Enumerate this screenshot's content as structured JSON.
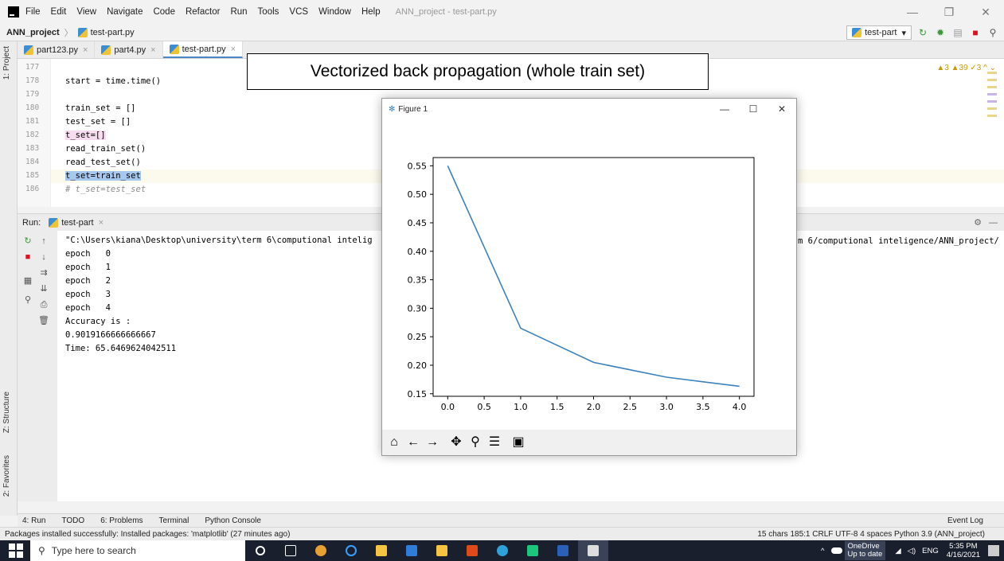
{
  "menu": {
    "items": [
      "File",
      "Edit",
      "View",
      "Navigate",
      "Code",
      "Refactor",
      "Run",
      "Tools",
      "VCS",
      "Window",
      "Help"
    ],
    "window_title": "ANN_project - test-part.py"
  },
  "nav": {
    "project": "ANN_project",
    "file": "test-part.py"
  },
  "run_config": {
    "label": "test-part"
  },
  "tabs": [
    "part123.py",
    "part4.py",
    "test-part.py"
  ],
  "editor": {
    "line_numbers": [
      "177",
      "178",
      "179",
      "180",
      "181",
      "182",
      "183",
      "184",
      "185",
      "186"
    ],
    "lines": [
      "",
      "start = time.time()",
      "",
      "train_set = []",
      "test_set = []",
      "t_set=[]",
      "read_train_set()",
      "read_test_set()",
      "t_set=train_set",
      "# t_set=test_set"
    ],
    "inspections": "▲3  ▲39  ✓3  ^  ⌄"
  },
  "caption": "Vectorized back propagation (whole train set)",
  "run": {
    "header": "Run:",
    "config": "test-part",
    "lines": [
      "\"C:\\Users\\kiana\\Desktop\\university\\term 6\\computional intelig",
      "epoch   0",
      "epoch   1",
      "epoch   2",
      "epoch   3",
      "epoch   4",
      "Accuracy is :",
      "0.9019166666666667",
      "Time: 65.6469624042511"
    ],
    "tail": "m 6/computional inteligence/ANN_project/"
  },
  "bottom_tabs": [
    "4: Run",
    "TODO",
    "6: Problems",
    "Terminal",
    "Python Console"
  ],
  "event_log": "Event Log",
  "status": {
    "message": "Packages installed successfully: Installed packages: 'matplotlib' (27 minutes ago)",
    "right": "15 chars   185:1   CRLF   UTF-8   4 spaces   Python 3.9 (ANN_project)"
  },
  "taskbar": {
    "search_placeholder": "Type here to search",
    "onedrive": "OneDrive",
    "onedrive_sub": "Up to date",
    "lang": "ENG",
    "time": "5:35 PM",
    "date": "4/16/2021"
  },
  "left_tools": [
    "1: Project",
    "Z: Structure",
    "2: Favorites"
  ],
  "figure": {
    "title": "Figure 1"
  },
  "chart_data": {
    "type": "line",
    "x": [
      0.0,
      1.0,
      2.0,
      3.0,
      4.0
    ],
    "y": [
      0.55,
      0.265,
      0.205,
      0.179,
      0.163
    ],
    "xticks": [
      "0.0",
      "0.5",
      "1.0",
      "1.5",
      "2.0",
      "2.5",
      "3.0",
      "3.5",
      "4.0"
    ],
    "yticks": [
      "0.15",
      "0.20",
      "0.25",
      "0.30",
      "0.35",
      "0.40",
      "0.45",
      "0.50",
      "0.55"
    ],
    "xlim": [
      -0.2,
      4.2
    ],
    "ylim": [
      0.1455,
      0.5645
    ],
    "line_color": "#3b82bd",
    "title": "",
    "xlabel": "",
    "ylabel": ""
  }
}
